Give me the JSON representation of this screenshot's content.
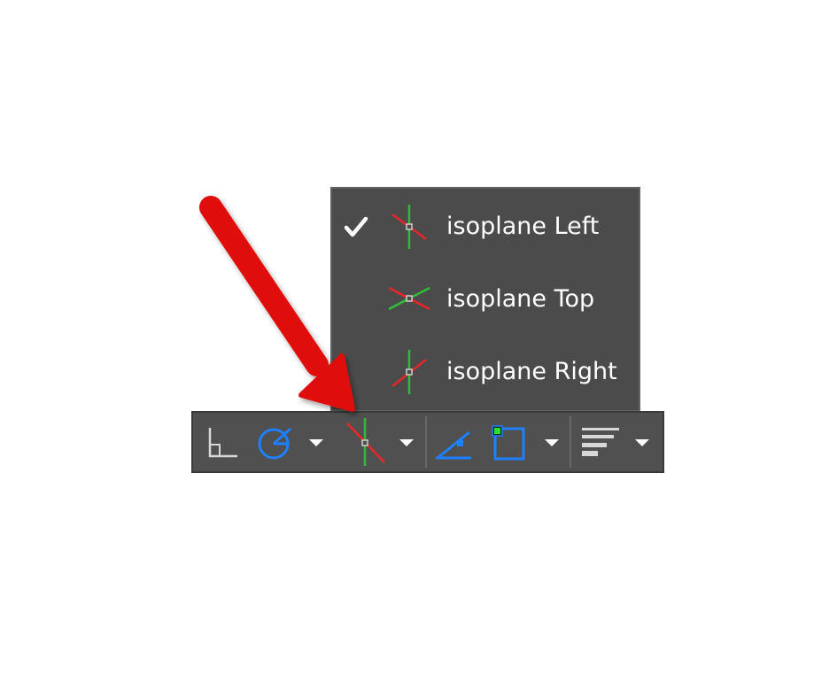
{
  "isoplane_menu": {
    "items": [
      {
        "label": "isoplane Left",
        "icon": "isoplane-left-icon",
        "checked": true
      },
      {
        "label": "isoplane Top",
        "icon": "isoplane-top-icon",
        "checked": false
      },
      {
        "label": "isoplane Right",
        "icon": "isoplane-right-icon",
        "checked": false
      }
    ]
  },
  "status_bar": {
    "buttons": [
      {
        "icon": "ortho-mode-icon"
      },
      {
        "icon": "polar-tracking-icon",
        "has_dropdown": true
      },
      {
        "icon": "isodraft-icon",
        "has_dropdown": true
      },
      {
        "icon": "object-snap-tracking-icon"
      },
      {
        "icon": "object-snap-icon",
        "has_dropdown": true
      },
      {
        "icon": "lineweight-icon",
        "has_dropdown": true
      }
    ]
  },
  "colors": {
    "menu_background": "#4b4b4b",
    "toolbar_background": "#505050",
    "accent_blue": "#1e7fff",
    "axis_red": "#e8262a",
    "axis_green": "#35b93a",
    "annotation_arrow": "#e01010"
  }
}
